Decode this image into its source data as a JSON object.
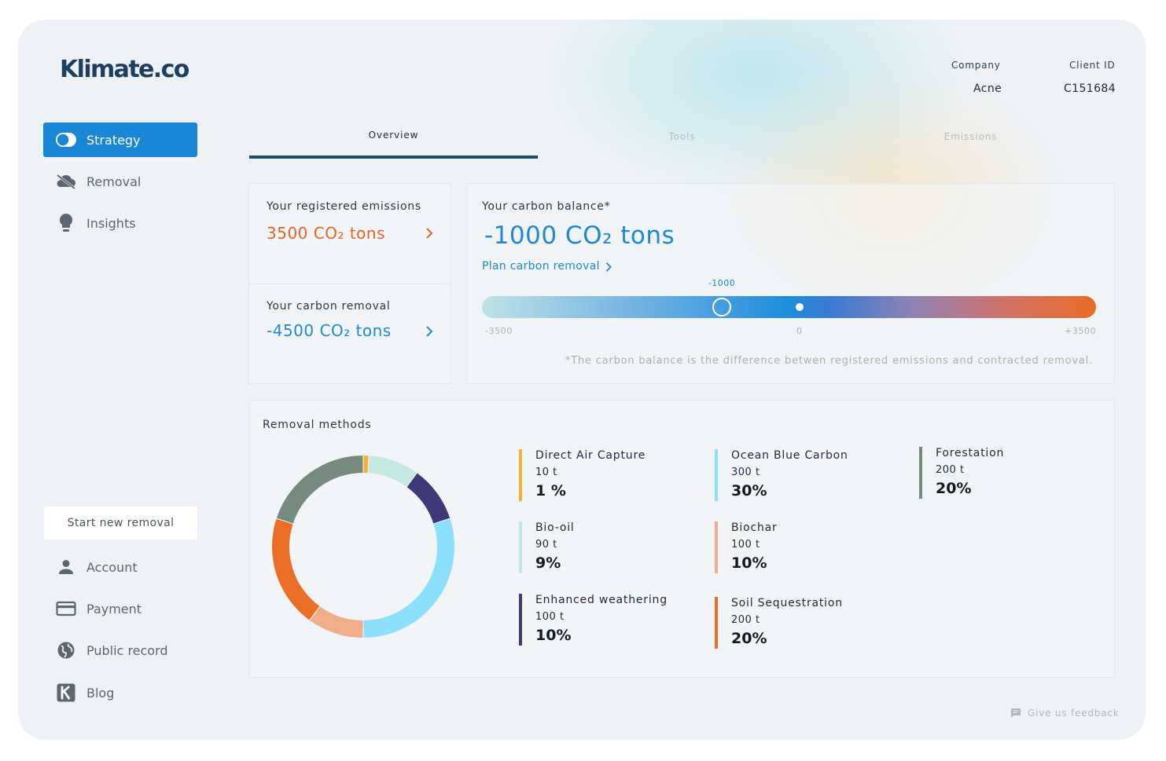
{
  "brand": {
    "logo_text": "Klimate.co"
  },
  "account_meta": {
    "company_label": "Company",
    "company_value": "Acne",
    "client_id_label": "Client ID",
    "client_id_value": "C151684"
  },
  "sidebar": {
    "items": [
      {
        "label": "Strategy",
        "icon": "toggle-icon",
        "active": true
      },
      {
        "label": "Removal",
        "icon": "cloud-off-icon",
        "active": false
      },
      {
        "label": "Insights",
        "icon": "lightbulb-icon",
        "active": false
      }
    ],
    "new_removal_button": "Start new removal",
    "bottom_items": [
      {
        "label": "Account",
        "icon": "person-icon"
      },
      {
        "label": "Payment",
        "icon": "credit-card-icon"
      },
      {
        "label": "Public record",
        "icon": "globe-icon"
      },
      {
        "label": "Blog",
        "icon": "k-logo-icon"
      }
    ]
  },
  "tabs": [
    {
      "label": "Overview",
      "active": true
    },
    {
      "label": "Tools",
      "active": false
    },
    {
      "label": "Emissions",
      "active": false
    }
  ],
  "emissions_card": {
    "title": "Your registered emissions",
    "value": "3500 CO₂ tons"
  },
  "removal_card": {
    "title": "Your carbon removal",
    "value": "-4500 CO₂ tons"
  },
  "balance_card": {
    "title": "Your carbon balance*",
    "value": "-1000 CO₂ tons",
    "link": "Plan carbon removal",
    "slider": {
      "min": -3500,
      "max": 3500,
      "current": -1000,
      "zero": 0,
      "marker_label": "-1000",
      "min_label": "-3500",
      "zero_label": "0",
      "max_label": "+3500"
    },
    "footnote": "*The carbon balance is the difference betwen registered emissions and contracted removal."
  },
  "removal_methods": {
    "title": "Removal methods",
    "methods": [
      {
        "name": "Direct Air Capture",
        "amount": "10 t",
        "percent": "1 %",
        "share": 1,
        "color": "#f2b035"
      },
      {
        "name": "Bio-oil",
        "amount": "90 t",
        "percent": "9%",
        "share": 9,
        "color": "#c6e8e2"
      },
      {
        "name": "Enhanced weathering",
        "amount": "100 t",
        "percent": "10%",
        "share": 10,
        "color": "#3e3a78"
      },
      {
        "name": "Ocean Blue Carbon",
        "amount": "300 t",
        "percent": "30%",
        "share": 30,
        "color": "#8de0fb"
      },
      {
        "name": "Biochar",
        "amount": "100 t",
        "percent": "10%",
        "share": 10,
        "color": "#f0ad8a"
      },
      {
        "name": "Soil Sequestration",
        "amount": "200 t",
        "percent": "20%",
        "share": 20,
        "color": "#eb6e27"
      },
      {
        "name": "Forestation",
        "amount": "200 t",
        "percent": "20%",
        "share": 20,
        "color": "#778a80"
      }
    ]
  },
  "feedback": {
    "label": "Give us feedback",
    "icon": "chat-icon"
  },
  "colors": {
    "accent_blue": "#1f88d6",
    "accent_orange": "#e7632a",
    "brand_navy": "#1c3e5f"
  }
}
